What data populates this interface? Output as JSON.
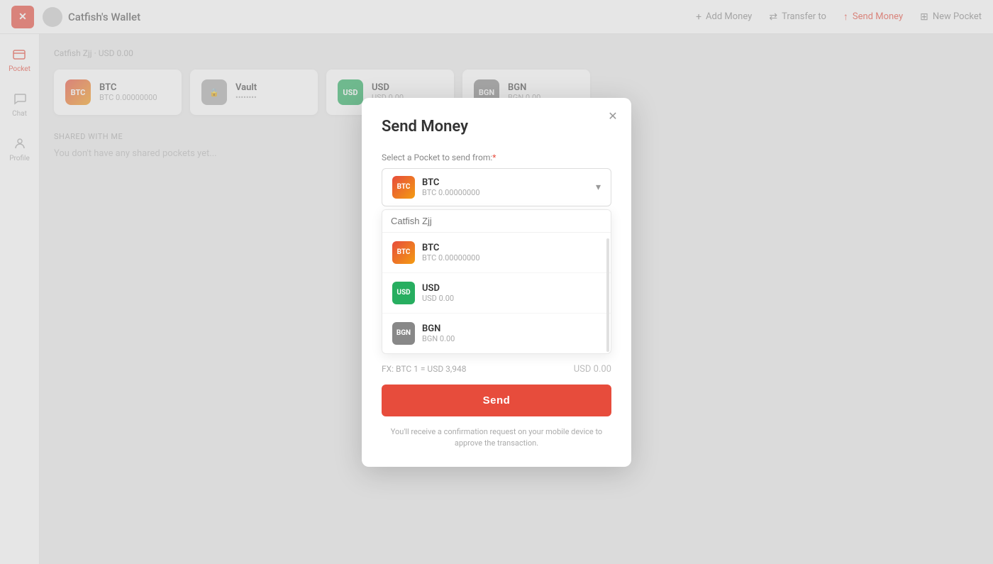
{
  "app": {
    "title": "Catfish's Wallet",
    "close_label": "✕"
  },
  "nav": {
    "actions": [
      {
        "id": "add-money",
        "label": "Add Money",
        "icon": "+"
      },
      {
        "id": "transfer-to",
        "label": "Transfer to",
        "icon": "→"
      },
      {
        "id": "send-money",
        "label": "Send Money",
        "icon": "↑",
        "active": true
      },
      {
        "id": "new-pocket",
        "label": "New Pocket",
        "icon": "⊞"
      }
    ]
  },
  "sidebar": {
    "items": [
      {
        "id": "pocket",
        "label": "Pocket",
        "icon": "◫",
        "active": true
      },
      {
        "id": "chat",
        "label": "Chat",
        "icon": "◻"
      },
      {
        "id": "profile",
        "label": "Profile",
        "icon": "◯"
      }
    ]
  },
  "main": {
    "breadcrumb": "Catfish Zjj · USD 0.00",
    "shared_section_title": "SHARED WITH ME",
    "shared_empty_text": "You don't have any shared pockets yet...",
    "pockets": [
      {
        "id": "btc",
        "name": "BTC",
        "value": "BTC 0.00000000",
        "type": "btc"
      },
      {
        "id": "vault",
        "name": "Vault",
        "value": "••••••••",
        "type": "vault"
      },
      {
        "id": "usd",
        "name": "USD",
        "value": "USD 0.00",
        "type": "usd"
      },
      {
        "id": "bgn",
        "name": "BGN",
        "value": "BGN 0.00",
        "type": "bgn"
      }
    ]
  },
  "modal": {
    "title": "Send Money",
    "close_label": "✕",
    "field_label": "Select a Pocket to send from:",
    "field_required": "*",
    "selected_pocket": {
      "name": "BTC",
      "value": "BTC 0.00000000",
      "type": "btc"
    },
    "dropdown_search_placeholder": "Catfish Zjj",
    "dropdown_items": [
      {
        "id": "btc",
        "name": "BTC",
        "value": "BTC 0.00000000",
        "type": "btc"
      },
      {
        "id": "usd",
        "name": "USD",
        "value": "USD 0.00",
        "type": "usd"
      },
      {
        "id": "bgn",
        "name": "BGN",
        "value": "BGN 0.00",
        "type": "bgn"
      }
    ],
    "fx_label": "FX: BTC 1 = USD 3,948",
    "fx_amount": "USD 0.00",
    "send_button_label": "Send",
    "footer_text": "You'll receive a confirmation request on your mobile device to approve the transaction."
  }
}
